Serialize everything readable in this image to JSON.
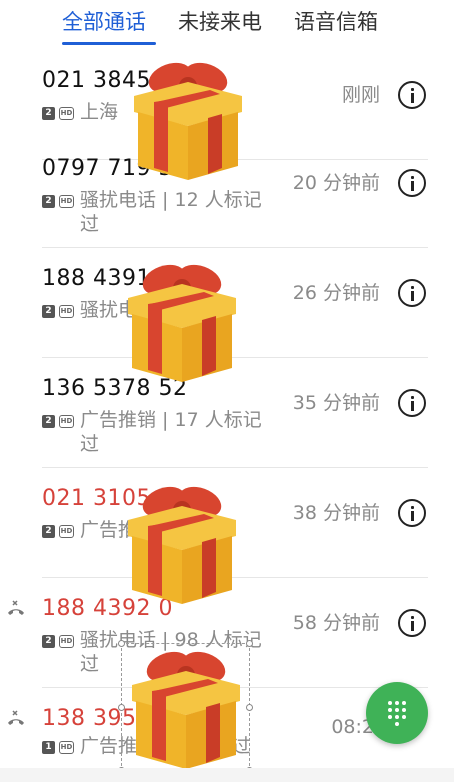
{
  "tabs": [
    {
      "label": "全部通话"
    },
    {
      "label": "未接来电"
    },
    {
      "label": "语音信箱"
    }
  ],
  "calls": [
    {
      "number": "021 3845",
      "sim": "2",
      "hd": "HD",
      "detail": "上海",
      "time": "刚刚",
      "missed": false
    },
    {
      "number": "0797 719 3",
      "sim": "2",
      "hd": "HD",
      "detail": "骚扰电话 | 12 人标记过",
      "time": "20 分钟前",
      "missed": false
    },
    {
      "number": "188 4391",
      "sim": "2",
      "hd": "HD",
      "detail": "骚扰电话 | 标记过",
      "time": "26 分钟前",
      "missed": false
    },
    {
      "number": "136 5378 52",
      "sim": "2",
      "hd": "HD",
      "detail": "广告推销 | 17 人标记过",
      "time": "35 分钟前",
      "missed": false
    },
    {
      "number": "021 3105",
      "sim": "2",
      "hd": "HD",
      "detail": "广告推销 | 标记过",
      "time": "38 分钟前",
      "missed": true
    },
    {
      "number": "188 4392 0",
      "sim": "2",
      "hd": "HD",
      "detail": "骚扰电话 | 98 人标记过",
      "time": "58 分钟前",
      "missed": true
    },
    {
      "number": "138 395",
      "sim": "1",
      "hd": "HD",
      "detail": "广告推销 | 人标记过",
      "time": "08:2",
      "missed": true
    }
  ],
  "colors": {
    "accent": "#1f5fd6",
    "missed": "#d6423a",
    "fab": "#3fb257"
  }
}
